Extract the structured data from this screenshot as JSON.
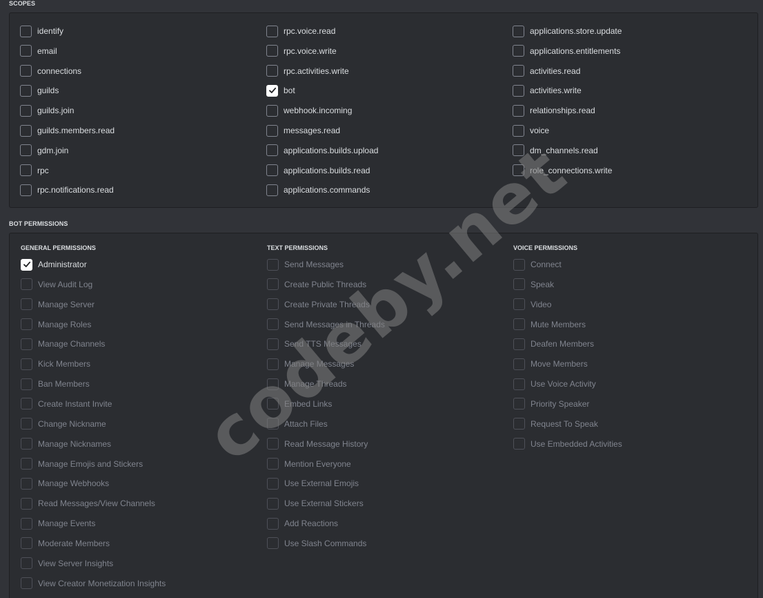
{
  "scopes": {
    "title": "SCOPES",
    "columns": [
      [
        {
          "label": "identify",
          "checked": false
        },
        {
          "label": "email",
          "checked": false
        },
        {
          "label": "connections",
          "checked": false
        },
        {
          "label": "guilds",
          "checked": false
        },
        {
          "label": "guilds.join",
          "checked": false
        },
        {
          "label": "guilds.members.read",
          "checked": false
        },
        {
          "label": "gdm.join",
          "checked": false
        },
        {
          "label": "rpc",
          "checked": false
        },
        {
          "label": "rpc.notifications.read",
          "checked": false
        }
      ],
      [
        {
          "label": "rpc.voice.read",
          "checked": false
        },
        {
          "label": "rpc.voice.write",
          "checked": false
        },
        {
          "label": "rpc.activities.write",
          "checked": false
        },
        {
          "label": "bot",
          "checked": true
        },
        {
          "label": "webhook.incoming",
          "checked": false
        },
        {
          "label": "messages.read",
          "checked": false
        },
        {
          "label": "applications.builds.upload",
          "checked": false
        },
        {
          "label": "applications.builds.read",
          "checked": false
        },
        {
          "label": "applications.commands",
          "checked": false
        }
      ],
      [
        {
          "label": "applications.store.update",
          "checked": false
        },
        {
          "label": "applications.entitlements",
          "checked": false
        },
        {
          "label": "activities.read",
          "checked": false
        },
        {
          "label": "activities.write",
          "checked": false
        },
        {
          "label": "relationships.read",
          "checked": false
        },
        {
          "label": "voice",
          "checked": false
        },
        {
          "label": "dm_channels.read",
          "checked": false
        },
        {
          "label": "role_connections.write",
          "checked": false
        }
      ]
    ]
  },
  "bot_permissions": {
    "title": "BOT PERMISSIONS",
    "groups": [
      {
        "title": "GENERAL PERMISSIONS",
        "items": [
          {
            "label": "Administrator",
            "checked": true,
            "disabled": false
          },
          {
            "label": "View Audit Log",
            "checked": false,
            "disabled": true
          },
          {
            "label": "Manage Server",
            "checked": false,
            "disabled": true
          },
          {
            "label": "Manage Roles",
            "checked": false,
            "disabled": true
          },
          {
            "label": "Manage Channels",
            "checked": false,
            "disabled": true
          },
          {
            "label": "Kick Members",
            "checked": false,
            "disabled": true
          },
          {
            "label": "Ban Members",
            "checked": false,
            "disabled": true
          },
          {
            "label": "Create Instant Invite",
            "checked": false,
            "disabled": true
          },
          {
            "label": "Change Nickname",
            "checked": false,
            "disabled": true
          },
          {
            "label": "Manage Nicknames",
            "checked": false,
            "disabled": true
          },
          {
            "label": "Manage Emojis and Stickers",
            "checked": false,
            "disabled": true
          },
          {
            "label": "Manage Webhooks",
            "checked": false,
            "disabled": true
          },
          {
            "label": "Read Messages/View Channels",
            "checked": false,
            "disabled": true
          },
          {
            "label": "Manage Events",
            "checked": false,
            "disabled": true
          },
          {
            "label": "Moderate Members",
            "checked": false,
            "disabled": true
          },
          {
            "label": "View Server Insights",
            "checked": false,
            "disabled": true
          },
          {
            "label": "View Creator Monetization Insights",
            "checked": false,
            "disabled": true
          }
        ]
      },
      {
        "title": "TEXT PERMISSIONS",
        "items": [
          {
            "label": "Send Messages",
            "checked": false,
            "disabled": true
          },
          {
            "label": "Create Public Threads",
            "checked": false,
            "disabled": true
          },
          {
            "label": "Create Private Threads",
            "checked": false,
            "disabled": true
          },
          {
            "label": "Send Messages in Threads",
            "checked": false,
            "disabled": true
          },
          {
            "label": "Send TTS Messages",
            "checked": false,
            "disabled": true
          },
          {
            "label": "Manage Messages",
            "checked": false,
            "disabled": true
          },
          {
            "label": "Manage Threads",
            "checked": false,
            "disabled": true
          },
          {
            "label": "Embed Links",
            "checked": false,
            "disabled": true
          },
          {
            "label": "Attach Files",
            "checked": false,
            "disabled": true
          },
          {
            "label": "Read Message History",
            "checked": false,
            "disabled": true
          },
          {
            "label": "Mention Everyone",
            "checked": false,
            "disabled": true
          },
          {
            "label": "Use External Emojis",
            "checked": false,
            "disabled": true
          },
          {
            "label": "Use External Stickers",
            "checked": false,
            "disabled": true
          },
          {
            "label": "Add Reactions",
            "checked": false,
            "disabled": true
          },
          {
            "label": "Use Slash Commands",
            "checked": false,
            "disabled": true
          }
        ]
      },
      {
        "title": "VOICE PERMISSIONS",
        "items": [
          {
            "label": "Connect",
            "checked": false,
            "disabled": true
          },
          {
            "label": "Speak",
            "checked": false,
            "disabled": true
          },
          {
            "label": "Video",
            "checked": false,
            "disabled": true
          },
          {
            "label": "Mute Members",
            "checked": false,
            "disabled": true
          },
          {
            "label": "Deafen Members",
            "checked": false,
            "disabled": true
          },
          {
            "label": "Move Members",
            "checked": false,
            "disabled": true
          },
          {
            "label": "Use Voice Activity",
            "checked": false,
            "disabled": true
          },
          {
            "label": "Priority Speaker",
            "checked": false,
            "disabled": true
          },
          {
            "label": "Request To Speak",
            "checked": false,
            "disabled": true
          },
          {
            "label": "Use Embedded Activities",
            "checked": false,
            "disabled": true
          }
        ]
      }
    ]
  },
  "watermark": "codeby.net",
  "icons": {
    "checkbox_checked": "checkmark-icon"
  },
  "colors": {
    "background": "#313338",
    "panel": "#2b2d31",
    "text": "#dbdee1",
    "disabled_text": "#80848e",
    "checked_box": "#ffffff"
  }
}
